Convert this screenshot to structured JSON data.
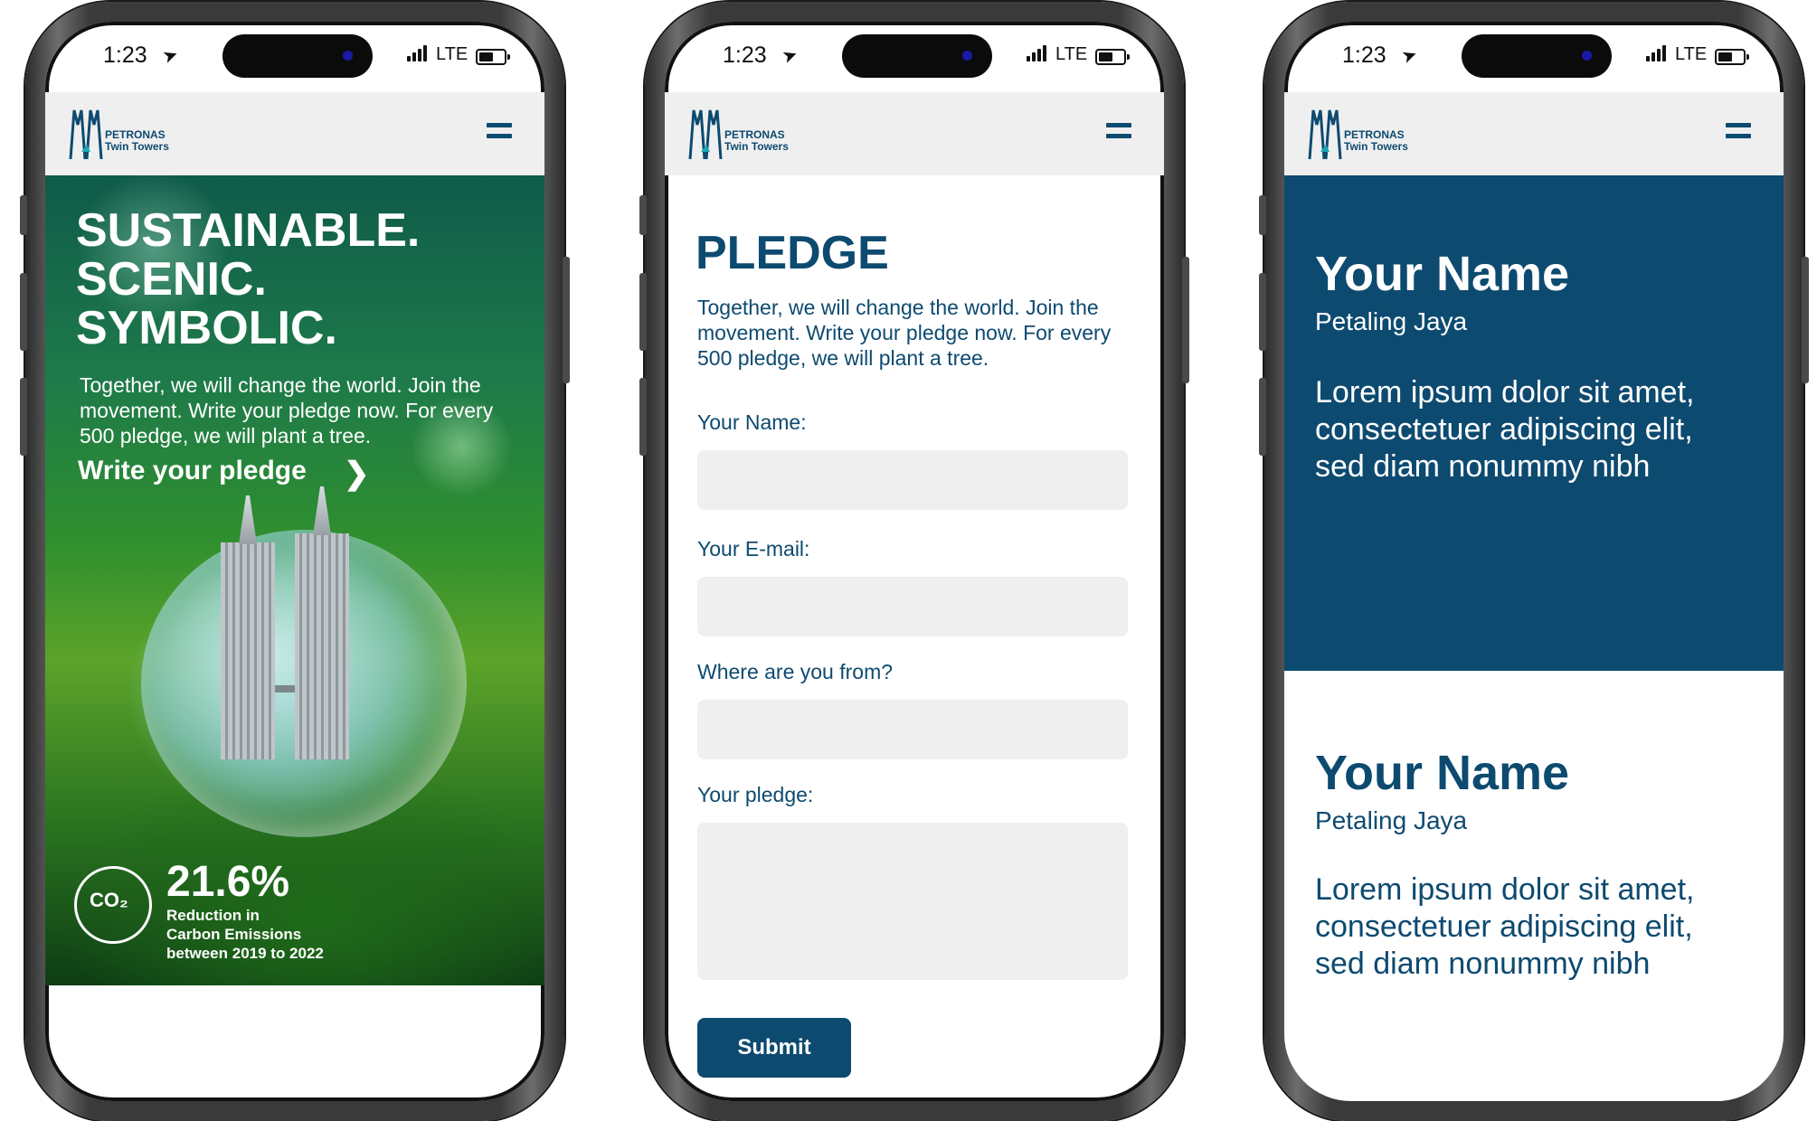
{
  "status_bar": {
    "time": "1:23",
    "network": "LTE"
  },
  "logo": {
    "line1": "PETRONAS",
    "line2": "Twin Towers"
  },
  "icons": {
    "location": "location-arrow-icon",
    "signal": "signal-bars-icon",
    "battery": "battery-icon",
    "menu": "hamburger-menu-icon",
    "chevron": "chevron-right-icon",
    "co2": "co2-cloud-icon"
  },
  "colors": {
    "brand_blue": "#0d4a70",
    "header_bg": "#efefef",
    "input_bg": "#efefef"
  },
  "hero": {
    "title_line1": "SUSTAINABLE.",
    "title_line2": "SCENIC.",
    "title_line3": "SYMBOLIC.",
    "body": "Together, we will change the world. Join the movement. Write your pledge now. For every 500 pledge, we will plant a tree.",
    "cta": "Write your pledge",
    "stat_value": "21.6%",
    "stat_line1": "Reduction in",
    "stat_line2": "Carbon Emissions",
    "stat_line3": "between 2019 to 2022",
    "co2_text": "CO₂"
  },
  "pledge": {
    "title": "PLEDGE",
    "intro": "Together, we will change the world. Join the movement. Write your pledge now. For every 500 pledge, we will plant a tree.",
    "name_label": "Your Name:",
    "email_label": "Your E-mail:",
    "from_label": "Where are you from?",
    "pledge_label": "Your pledge:",
    "submit_label": "Submit"
  },
  "cards": [
    {
      "name": "Your Name",
      "city": "Petaling Jaya",
      "text": "Lorem ipsum dolor sit amet, consectetuer adipiscing elit, sed diam nonummy nibh"
    },
    {
      "name": "Your Name",
      "city": "Petaling Jaya",
      "text": "Lorem ipsum dolor sit amet, consectetuer adipiscing elit, sed diam nonummy nibh"
    }
  ]
}
